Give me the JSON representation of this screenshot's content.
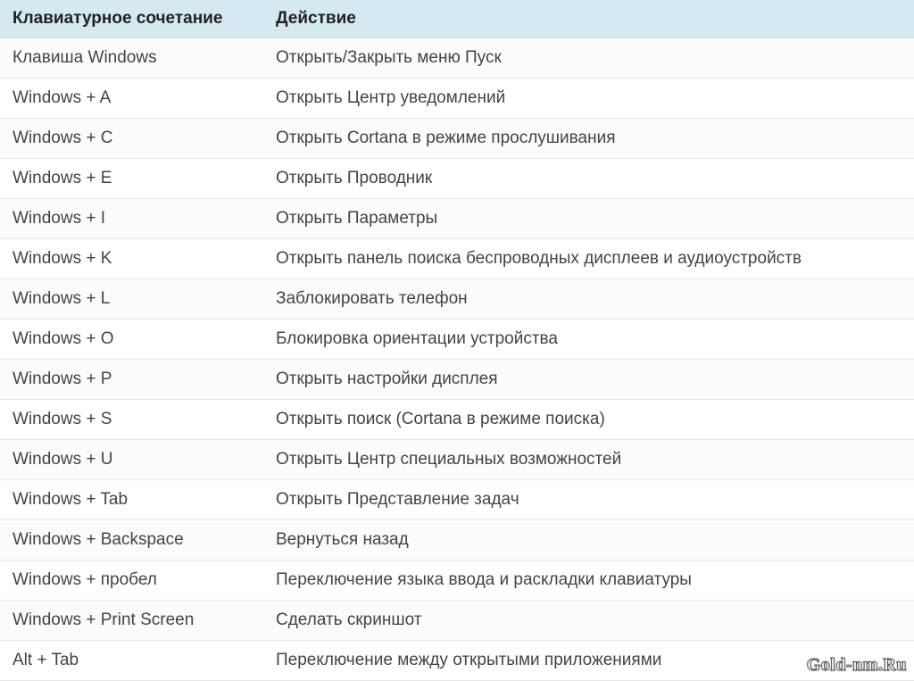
{
  "table": {
    "headers": {
      "shortcut": "Клавиатурное сочетание",
      "action": "Действие"
    },
    "rows": [
      {
        "shortcut": "Клавиша Windows",
        "action": "Открыть/Закрыть меню Пуск"
      },
      {
        "shortcut": "Windows + A",
        "action": "Открыть Центр уведомлений"
      },
      {
        "shortcut": "Windows + C",
        "action": "Открыть Cortana в режиме прослушивания"
      },
      {
        "shortcut": "Windows + E",
        "action": "Открыть Проводник"
      },
      {
        "shortcut": "Windows + I",
        "action": "Открыть Параметры"
      },
      {
        "shortcut": "Windows + K",
        "action": "Открыть панель поиска беспроводных дисплеев и аудиоустройств"
      },
      {
        "shortcut": "Windows + L",
        "action": "Заблокировать телефон"
      },
      {
        "shortcut": "Windows + O",
        "action": "Блокировка ориентации устройства"
      },
      {
        "shortcut": "Windows + P",
        "action": "Открыть настройки дисплея"
      },
      {
        "shortcut": "Windows + S",
        "action": "Открыть поиск (Cortana в режиме поиска)"
      },
      {
        "shortcut": "Windows + U",
        "action": "Открыть Центр специальных возможностей"
      },
      {
        "shortcut": "Windows + Tab",
        "action": "Открыть Представление задач"
      },
      {
        "shortcut": "Windows + Backspace",
        "action": "Вернуться назад"
      },
      {
        "shortcut": "Windows + пробел",
        "action": "Переключение языка ввода и раскладки клавиатуры"
      },
      {
        "shortcut": "Windows + Print Screen",
        "action": "Сделать скриншот"
      },
      {
        "shortcut": "Alt + Tab",
        "action": "Переключение между открытыми приложениями"
      }
    ]
  },
  "watermark": "Gold-nm.Ru"
}
